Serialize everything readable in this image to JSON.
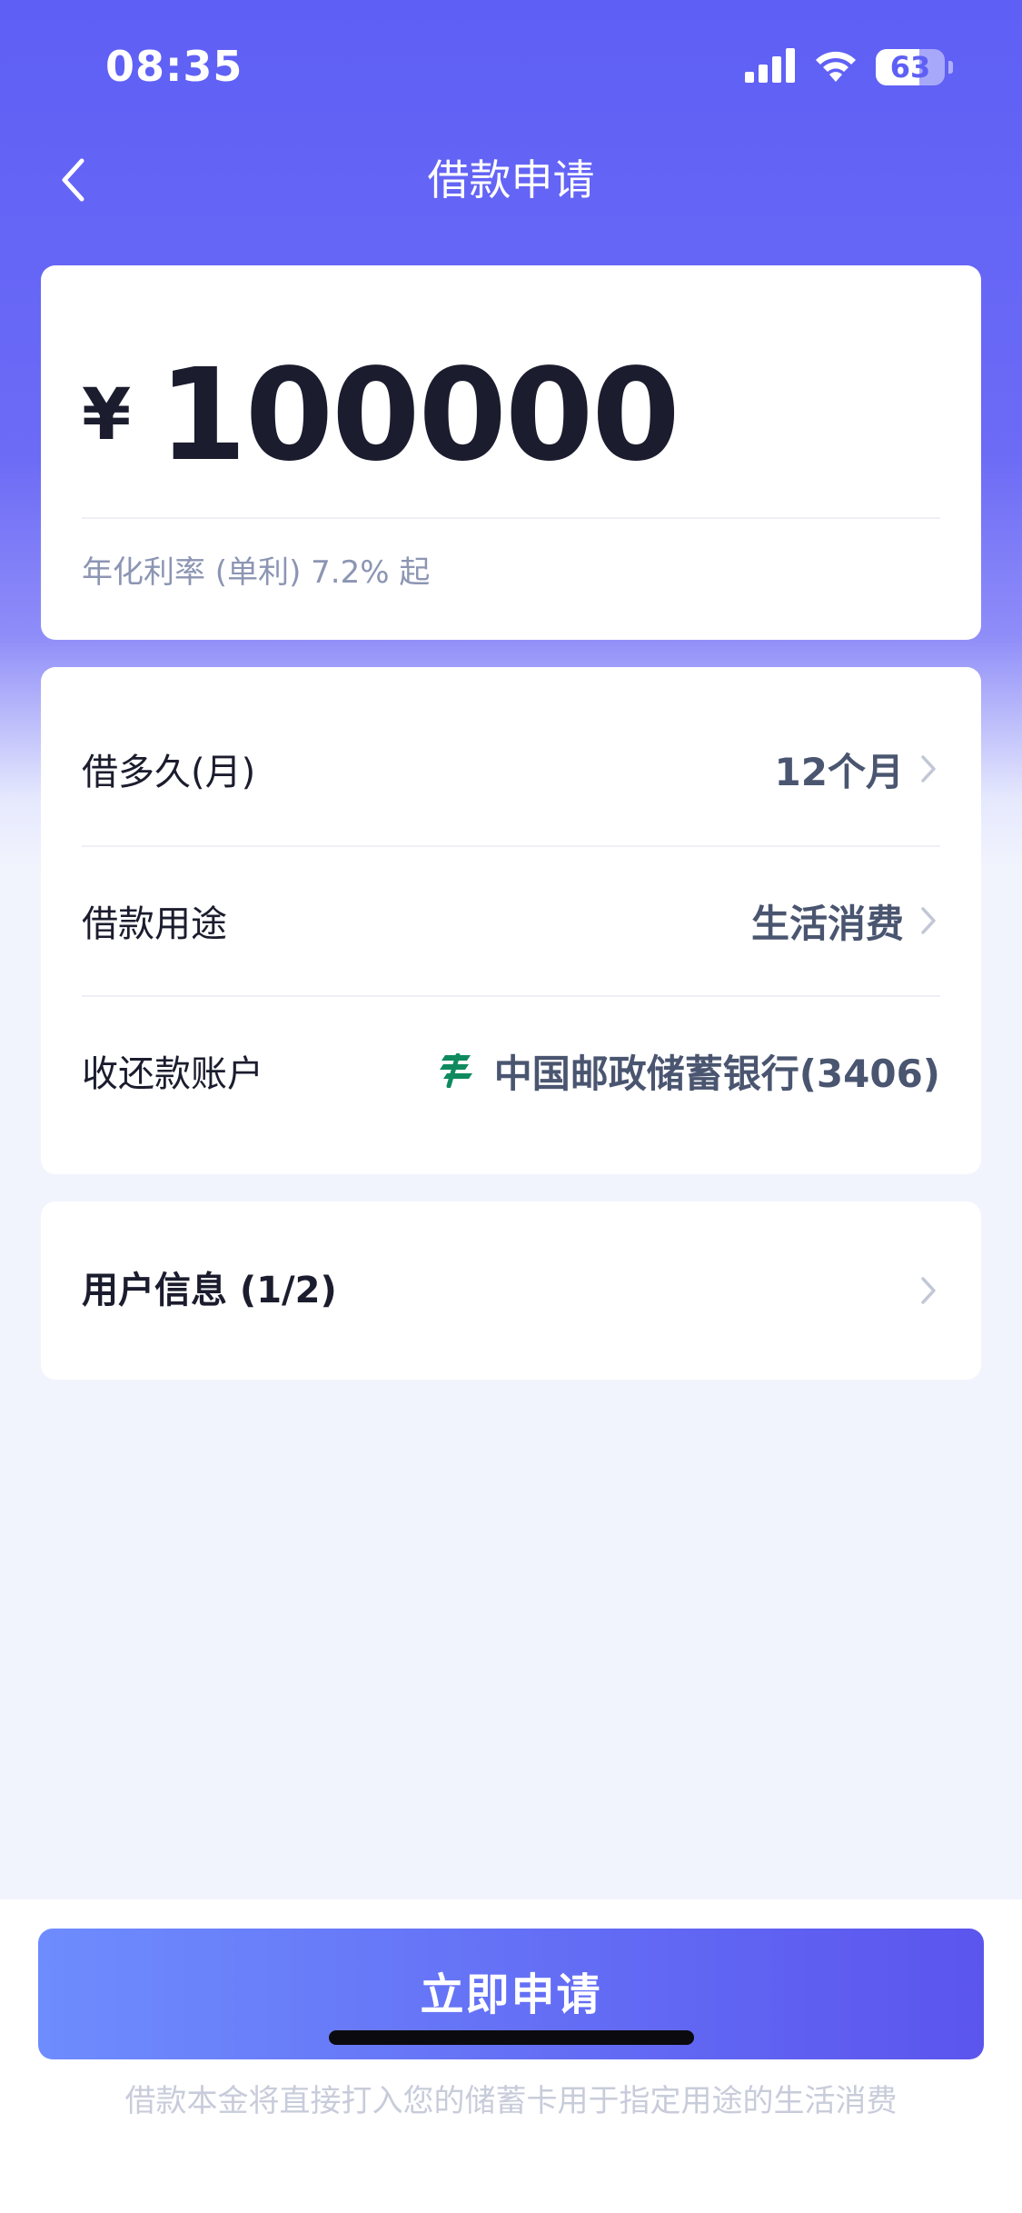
{
  "status_bar": {
    "time": "08:35",
    "battery_level": "63",
    "icons": [
      "cellular-signal-icon",
      "wifi-icon",
      "battery-icon"
    ]
  },
  "nav": {
    "title": "借款申请",
    "back_icon": "chevron-left-icon"
  },
  "amount_card": {
    "currency_symbol": "¥",
    "amount": "100000",
    "rate_text": "年化利率 (单利) 7.2% 起"
  },
  "details": {
    "term": {
      "label": "借多久(月)",
      "value": "12个月"
    },
    "purpose": {
      "label": "借款用途",
      "value": "生活消费"
    },
    "account": {
      "label": "收还款账户",
      "value": "中国邮政储蓄银行(3406)",
      "icon": "postal-bank-icon"
    }
  },
  "user_info": {
    "label": "用户信息 (1/2)"
  },
  "footer": {
    "apply_button": "立即申请",
    "disclaimer": "借款本金将直接打入您的储蓄卡用于指定用途的生活消费"
  },
  "colors": {
    "primary": "#5E5FF5",
    "button_start": "#6E8CFD",
    "button_end": "#5B55EE",
    "bank_green": "#0F8A5F",
    "text_dark": "#1B1D2E",
    "text_value": "#4A5570",
    "text_muted": "#8C95B3"
  }
}
